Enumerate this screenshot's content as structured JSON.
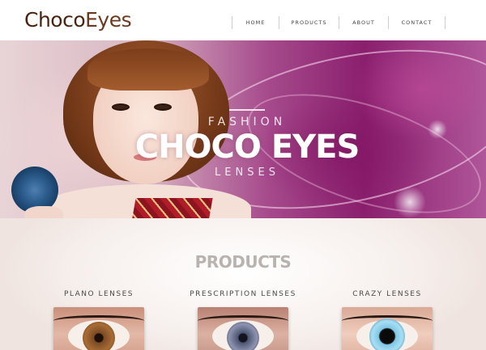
{
  "header": {
    "logo": {
      "part1": "Choco",
      "part2": "Eyes"
    },
    "nav": [
      "HOME",
      "PRODUCTS",
      "ABOUT",
      "CONTACT"
    ]
  },
  "hero": {
    "tagline_top": "FASHION",
    "title": "CHOCO EYES",
    "tagline_bottom": "LENSES"
  },
  "products": {
    "heading": "PRODUCTS",
    "items": [
      {
        "label": "PLANO LENSES"
      },
      {
        "label": "PRESCRIPTION LENSES"
      },
      {
        "label": "CRAZY LENSES"
      }
    ]
  },
  "colors": {
    "logo_brown": "#4a2410",
    "hero_magenta": "#8a1f6e",
    "heading_gray": "#b9b3b0"
  }
}
